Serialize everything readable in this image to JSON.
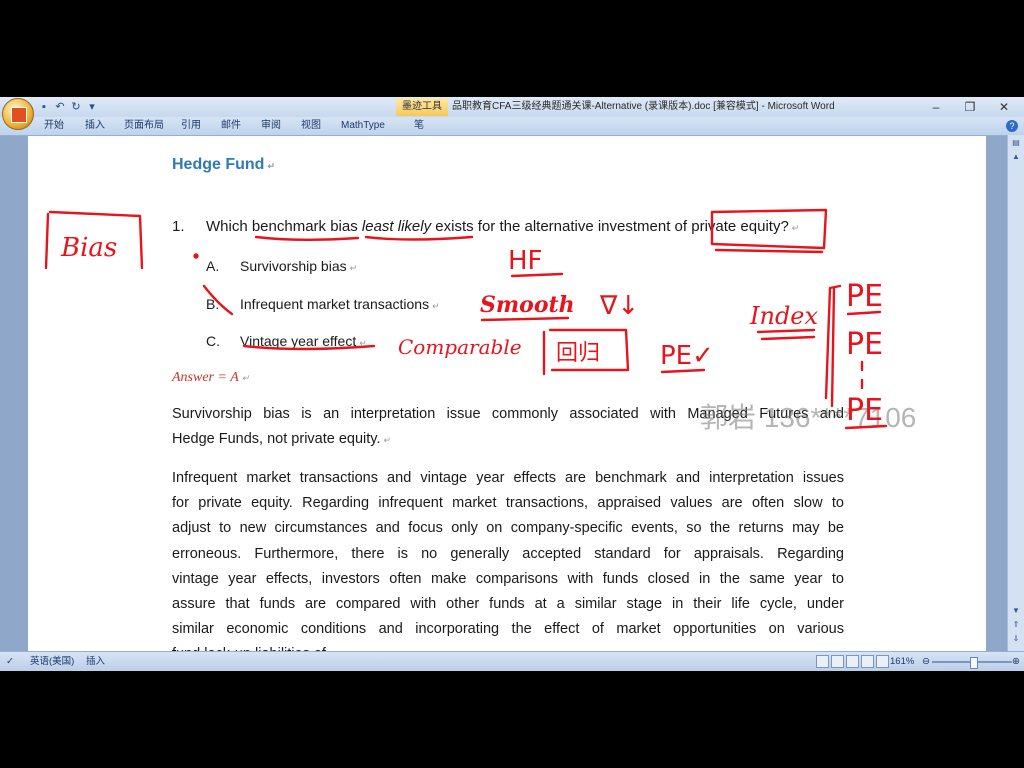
{
  "window": {
    "contextual_tab": "墨迹工具",
    "title": "品职教育CFA三级经典题通关课-Alternative (录课版本).doc [兼容模式] - Microsoft Word",
    "minimize": "–",
    "restore": "❐",
    "close": "✕"
  },
  "ribbon_tabs": [
    "开始",
    "插入",
    "页面布局",
    "引用",
    "邮件",
    "审阅",
    "视图",
    "MathType",
    "笔"
  ],
  "document": {
    "heading": "Hedge Fund",
    "question_number": "1.",
    "question_parts": [
      "Which benchmark bias ",
      "least likely",
      " exists for the alternative investment of private equity?"
    ],
    "options": [
      {
        "letter": "A.",
        "text": "Survivorship bias"
      },
      {
        "letter": "B.",
        "text": "Infrequent market transactions"
      },
      {
        "letter": "C.",
        "text": "Vintage year effect"
      }
    ],
    "answer": "Answer = A",
    "paragraph1": [
      "Survivorship bias is an interpretation issue commonly associated with Managed Futures and",
      "Hedge Funds, not private equity."
    ],
    "paragraph2": [
      "Infrequent market transactions and vintage year effects are benchmark and interpretation issues",
      "for private equity. Regarding infrequent market transactions, appraised values are often slow to",
      "adjust to new circumstances and focus only on company-specific events, so the returns may be",
      "erroneous. Furthermore, there is no generally accepted standard for appraisals. Regarding",
      "vintage year effects, investors often make comparisons with funds closed in the same year to",
      "assure that funds are compared with other funds at a similar stage in their life cycle, under",
      "similar economic conditions and incorporating the effect of market opportunities on various",
      "fund lock-up liabilities of"
    ],
    "watermark": "郭岩 136****7106"
  },
  "annotations": {
    "bias": "Bias",
    "hf": "HF",
    "smooth": "Smooth",
    "down": "∇↓",
    "comparable": "Comparable",
    "box_chars": "回归",
    "pe_check": "PE✓",
    "index": "Index",
    "pe": "PE"
  },
  "statusbar": {
    "language": "英语(美国)",
    "mode": "插入",
    "zoom": "161%"
  },
  "colors": {
    "heading": "#2f7bb3",
    "ink": "#e8141c",
    "answer": "#c0392b"
  }
}
